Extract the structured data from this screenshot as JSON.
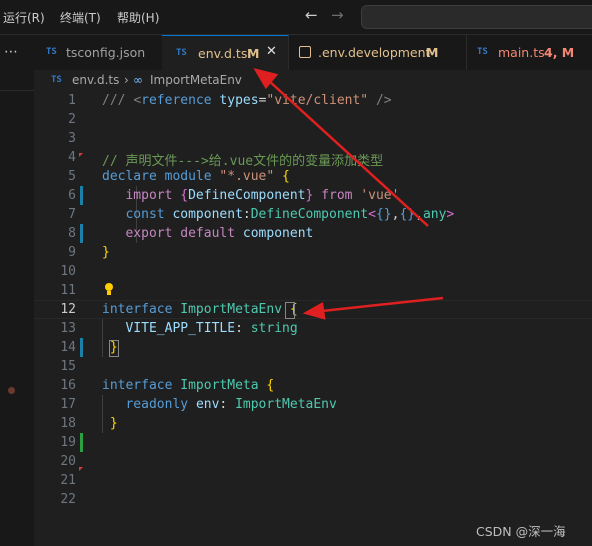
{
  "menubar": {
    "items": [
      "运行(R)",
      "终端(T)",
      "帮助(H)"
    ],
    "back_arrow": "←",
    "forward_arrow": "→"
  },
  "activity": {
    "more_glyph": "⋯"
  },
  "tabs": [
    {
      "icon": "TS",
      "label": "tsconfig.json",
      "modified": "",
      "active": false
    },
    {
      "icon": "TS",
      "label": "env.d.ts",
      "modified": "M",
      "active": true,
      "close": "✕"
    },
    {
      "icon": "terminal-icon",
      "label": ".env.development",
      "modified": "M",
      "active": false
    },
    {
      "icon": "TS",
      "label": "main.ts",
      "modified": "4, M",
      "active": false
    }
  ],
  "breadcrumb": {
    "file_icon": "TS",
    "file": "env.d.ts",
    "separator": "›",
    "symbol_icon": "∞",
    "symbol": "ImportMetaEnv"
  },
  "editor": {
    "line_numbers": [
      "1",
      "2",
      "3",
      "4",
      "5",
      "6",
      "7",
      "8",
      "9",
      "10",
      "11",
      "12",
      "13",
      "14",
      "15",
      "16",
      "17",
      "18",
      "19",
      "20",
      "21",
      "22"
    ],
    "current_line": "12"
  },
  "watermark": "CSDN @深一海",
  "colors": {
    "accent": "#0078d4",
    "annotation_arrow": "#e02020",
    "modified": "#e2c08d",
    "git_added": "#2ea043",
    "git_modified": "#1b81a8"
  }
}
